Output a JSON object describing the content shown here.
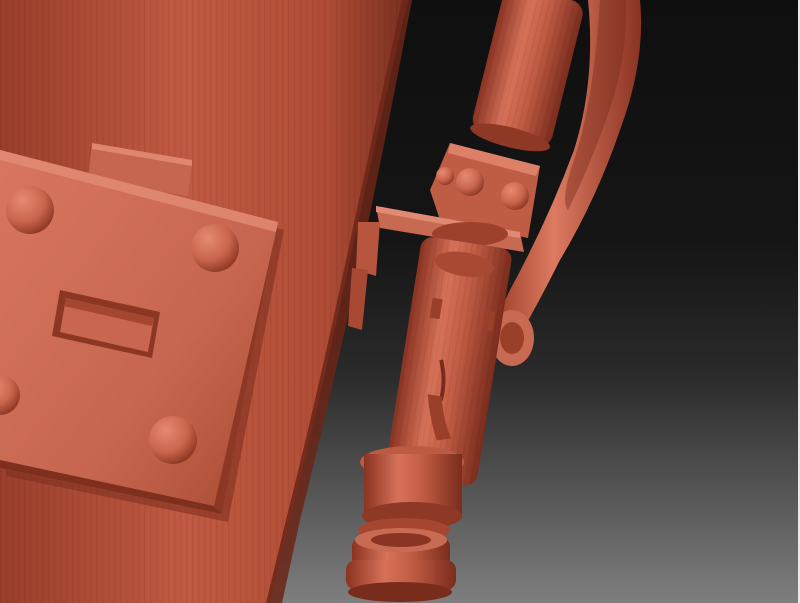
{
  "viewport": {
    "background_top": "#101010",
    "background_bottom": "#7e7e7e",
    "material_color": "#b8503a",
    "material_highlight": "#d7735c",
    "material_shadow": "#6e2a1b"
  },
  "icons": [
    "sculpt-body-mesh",
    "hinge-plate-mesh",
    "valve-assembly-mesh"
  ]
}
